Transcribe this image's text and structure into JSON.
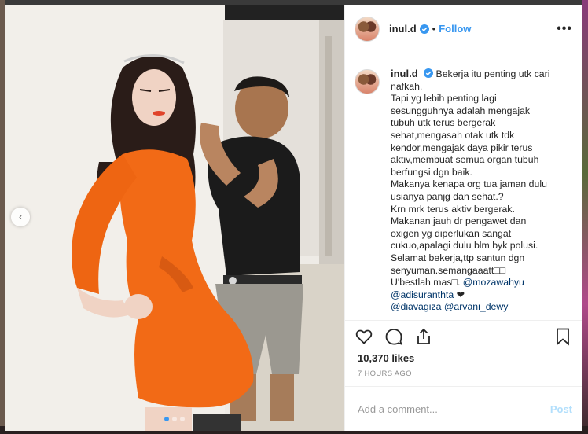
{
  "post": {
    "username": "inul.d",
    "separator": "•",
    "follow_label": "Follow",
    "more_label": "•••",
    "caption_username": "inul.d",
    "caption_lines": [
      "Bekerja itu penting utk cari",
      "nafkah.",
      "Tapi yg lebih penting lagi",
      "sesungguhnya adalah mengajak",
      "tubuh utk terus bergerak",
      "sehat,mengasah otak utk tdk",
      "kendor,mengajak daya pikir terus",
      "aktiv,membuat semua organ tubuh",
      "berfungsi dgn baik.",
      "Makanya kenapa org tua jaman dulu",
      "usianya panjg dan sehat.?",
      "Krn mrk terus aktiv bergerak.",
      "Makanan jauh dr pengawet dan",
      "oxigen yg diperlukan sangat",
      "cukuo,apalagi dulu blm byk polusi.",
      "Selamat bekerja,ttp santun dgn",
      "senyuman.semangaaatt□□",
      "U'bestlah mas□. ",
      "",
      "",
      ""
    ],
    "mentions": [
      "@mozawahyu",
      "@adisuranthta",
      "@diavagiza",
      "@arvani_dewy"
    ],
    "heart_emoji": "❤",
    "likes": "10,370 likes",
    "time_ago": "7 HOURS AGO",
    "comment_placeholder": "Add a comment...",
    "post_label": "Post",
    "carousel_prev_label": "‹",
    "carousel_dots": 3,
    "carousel_active_index": 0
  },
  "colors": {
    "accent": "#3897f0",
    "dress": "#f26a16",
    "text": "#262626",
    "muted": "#8e8e8e",
    "mention": "#003569"
  }
}
